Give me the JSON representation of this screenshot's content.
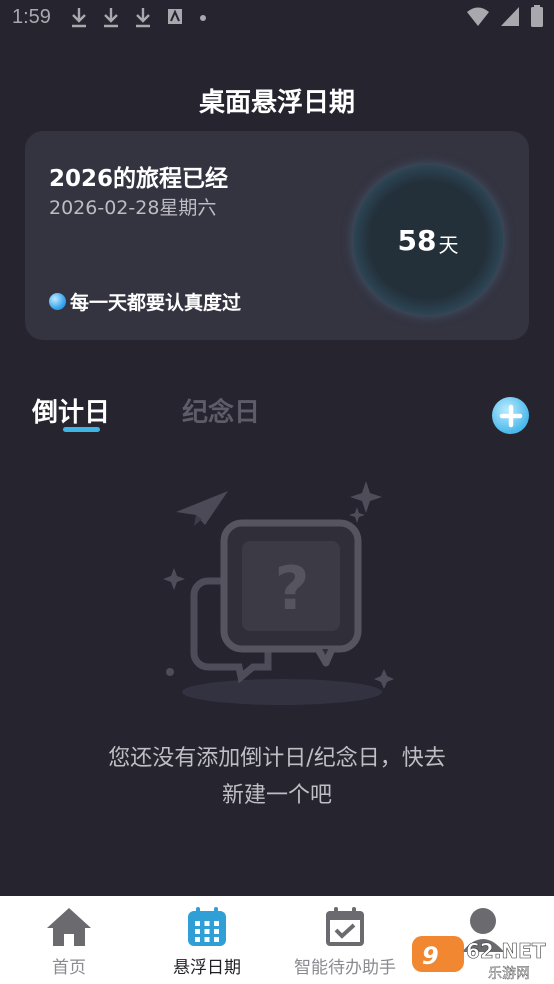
{
  "status_bar": {
    "time": "1:59"
  },
  "header": {
    "title": "桌面悬浮日期"
  },
  "summary_card": {
    "heading": "2026的旅程已经",
    "date": "2026-02-28星期六",
    "motto": "每一天都要认真度过",
    "days_value": "58",
    "days_unit": "天"
  },
  "tabs": [
    {
      "label": "倒计日",
      "active": true
    },
    {
      "label": "纪念日",
      "active": false
    }
  ],
  "empty_state": {
    "line1": "您还没有添加倒计日/纪念日，快去",
    "line2": "新建一个吧"
  },
  "bottom_nav": {
    "items": [
      {
        "label": "首页",
        "icon": "home-icon",
        "active": false
      },
      {
        "label": "悬浮日期",
        "icon": "calendar-grid-icon",
        "active": true
      },
      {
        "label": "智能待办助手",
        "icon": "calendar-check-icon",
        "active": false
      },
      {
        "label": "",
        "icon": "profile-icon",
        "active": false
      }
    ]
  },
  "watermark": {
    "text": "962.NET",
    "subtext": "乐游网"
  },
  "colors": {
    "background": "#25242f",
    "card": "#343340",
    "accent": "#3fb5e6",
    "nav_active_icon": "#2f9fd6",
    "nav_inactive_icon": "#6a6a6f"
  }
}
